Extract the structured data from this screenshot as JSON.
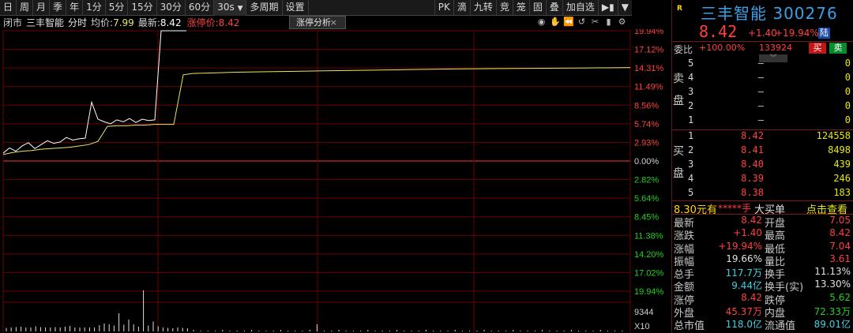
{
  "toolbar": {
    "periods": [
      "日",
      "周",
      "月",
      "季",
      "年",
      "1分",
      "5分",
      "15分",
      "30分",
      "60分"
    ],
    "interval": "30s",
    "interval_arrow": "▼",
    "multi_period": "多周期",
    "settings": "设置",
    "right_buttons": [
      "PK",
      "滴",
      "九转",
      "竞",
      "笼",
      "固",
      "叠",
      "加自选",
      "▶▮",
      "▼"
    ]
  },
  "infobar": {
    "status": "闭市",
    "name": "三丰智能",
    "tab_label": "分时",
    "avg_label": "均价:",
    "avg_value": "7.99",
    "last_label": "最新:",
    "last_value": "8.42",
    "limit_label": "涨停价:",
    "limit_value": "8.42",
    "analysis_tab": "涨停分析",
    "close_glyph": "×",
    "icons": [
      "eye-icon",
      "hand-icon",
      "rewind-icon",
      "undo-icon",
      "scissors-icon",
      "bar-icon",
      "gear-icon"
    ]
  },
  "chart_data": {
    "type": "line",
    "prev_close": 7.02,
    "up_pcts": [
      "19.94%",
      "17.12%",
      "14.31%",
      "11.49%",
      "8.56%",
      "5.74%",
      "2.93%"
    ],
    "zero_label": "0.00%",
    "down_pcts": [
      "2.82%",
      "5.64%",
      "8.45%",
      "11.38%",
      "14.20%",
      "17.02%",
      "19.94%"
    ],
    "volume_label": "9344",
    "volume_unit": "X10",
    "price_series_pct": [
      1.2,
      2.0,
      1.5,
      2.3,
      2.8,
      1.9,
      2.5,
      3.1,
      2.7,
      2.9,
      3.6,
      3.2,
      3.4,
      3.5,
      9.0,
      6.4,
      6.0,
      5.7,
      6.3,
      6.0,
      6.5,
      5.9,
      6.4,
      6.2,
      6.3,
      19.94,
      19.94,
      19.94,
      19.94,
      19.94
    ],
    "avg_series_pct": [
      1.0,
      1.3,
      1.5,
      1.6,
      1.8,
      1.9,
      2.0,
      2.1,
      2.3,
      2.5,
      3.0,
      5.3,
      5.4,
      5.4,
      5.5,
      5.5,
      5.6,
      5.6,
      5.6,
      13.2,
      13.4,
      13.6,
      13.7,
      13.8,
      13.9,
      14.0,
      14.1,
      14.15,
      14.2,
      14.25,
      14.3
    ],
    "volume_series": [
      0.9,
      1,
      1.1,
      1.2,
      1,
      1,
      1.3,
      1.1,
      1,
      1,
      1.1,
      1,
      1.2,
      1.4,
      1,
      1,
      1,
      1,
      1,
      1.6,
      2,
      1.8,
      1.5,
      4.6,
      1.7,
      3,
      1.8,
      1.2,
      9344,
      1.5,
      2.5,
      1.3,
      1,
      0.9,
      0.8,
      1,
      0.9,
      0.8
    ]
  },
  "stock": {
    "badge": "R",
    "name": "三丰智能",
    "code": "300276",
    "price": "8.42",
    "change": "+1.40",
    "change_pct": "+19.94%",
    "tag": "陆"
  },
  "weibi": {
    "label": "委比",
    "ratio": "+100.00%",
    "diff": "133924",
    "buy_label": "买",
    "sell_label": "卖"
  },
  "sell_side": {
    "label": "卖盘",
    "levels": [
      {
        "lvl": "5",
        "price": "–",
        "vol": "0"
      },
      {
        "lvl": "4",
        "price": "–",
        "vol": "0"
      },
      {
        "lvl": "3",
        "price": "–",
        "vol": "0"
      },
      {
        "lvl": "2",
        "price": "–",
        "vol": "0"
      },
      {
        "lvl": "1",
        "price": "–",
        "vol": "0"
      }
    ]
  },
  "buy_side": {
    "label": "买盘",
    "levels": [
      {
        "lvl": "1",
        "price": "8.42",
        "vol": "124558"
      },
      {
        "lvl": "2",
        "price": "8.41",
        "vol": "8498"
      },
      {
        "lvl": "3",
        "price": "8.40",
        "vol": "439"
      },
      {
        "lvl": "4",
        "price": "8.39",
        "vol": "246"
      },
      {
        "lvl": "5",
        "price": "8.38",
        "vol": "183"
      }
    ]
  },
  "big_buy": {
    "price": "8.30元有",
    "mask": "*****手",
    "label": "大买单",
    "action": "点击查看"
  },
  "stats": [
    {
      "l1": "最新",
      "v1": "8.42",
      "c1": "red",
      "l2": "开盘",
      "v2": "7.05",
      "c2": "red"
    },
    {
      "l1": "涨跌",
      "v1": "+1.40",
      "c1": "red",
      "l2": "最高",
      "v2": "8.42",
      "c2": "red"
    },
    {
      "l1": "涨幅",
      "v1": "+19.94%",
      "c1": "red",
      "l2": "最低",
      "v2": "7.04",
      "c2": "red"
    },
    {
      "l1": "振幅",
      "v1": "19.66%",
      "c1": "white",
      "l2": "量比",
      "v2": "3.61",
      "c2": "red"
    },
    {
      "l1": "总手",
      "v1": "117.7万",
      "c1": "cyan",
      "l2": "换手",
      "v2": "11.13%",
      "c2": "white"
    },
    {
      "l1": "金额",
      "v1": "9.44亿",
      "c1": "cyan",
      "l2": "换手(实)",
      "v2": "13.30%",
      "c2": "white"
    },
    {
      "l1": "涨停",
      "v1": "8.42",
      "c1": "red",
      "l2": "跌停",
      "v2": "5.62",
      "c2": "green"
    },
    {
      "l1": "外盘",
      "v1": "45.37万",
      "c1": "red",
      "l2": "内盘",
      "v2": "72.33万",
      "c2": "green"
    },
    {
      "l1": "总市值",
      "v1": "118.0亿",
      "c1": "cyan",
      "l2": "流通值",
      "v2": "89.01亿",
      "c2": "cyan"
    }
  ],
  "colors": {
    "up": "#ff4040",
    "down": "#20d020",
    "price_line": "#ffffff",
    "avg_line": "#e8e860",
    "grid": "#6a0000",
    "axis_text_up": "#ff4040",
    "axis_text_down": "#20d020"
  }
}
